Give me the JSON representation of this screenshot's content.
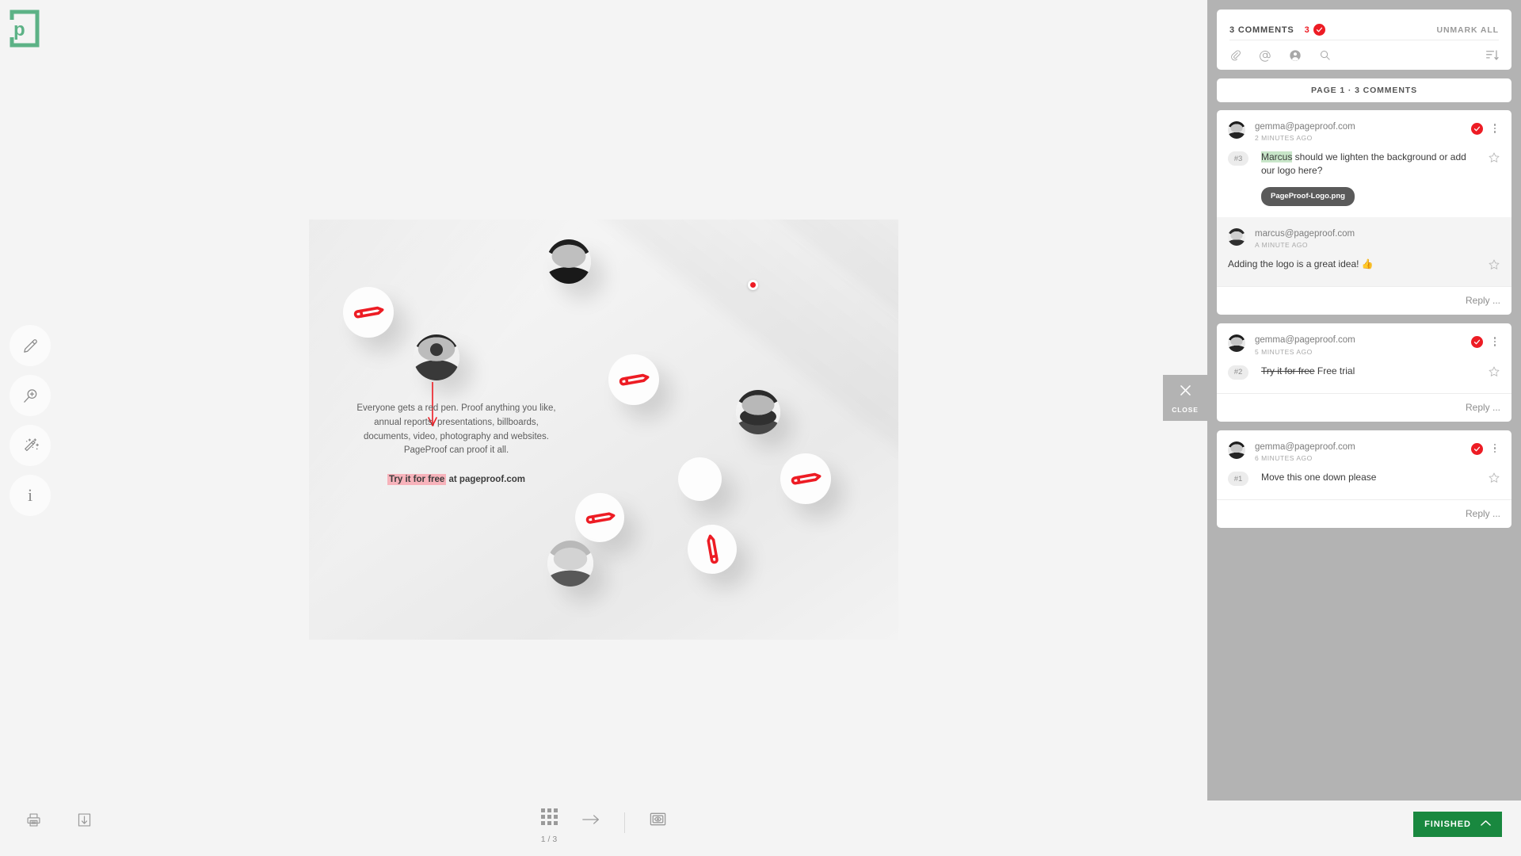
{
  "app": {
    "logo_name": "pageproof-logo",
    "brand_green": "#5cb286",
    "accent_red": "#ed1c24",
    "finished_green": "#19883f",
    "panel_grey": "#b3b3b3"
  },
  "tool_rail": {
    "items": [
      {
        "name": "pen-tool",
        "icon": "pen-icon",
        "label": "Pen"
      },
      {
        "name": "zoom-tool",
        "icon": "magnifier-icon",
        "label": "Zoom"
      },
      {
        "name": "magic-tool",
        "icon": "magic-wand-icon",
        "label": "Magic"
      },
      {
        "name": "info-tool",
        "icon": "info-icon",
        "label": "i"
      }
    ]
  },
  "viewer": {
    "close_tab": {
      "label": "CLOSE",
      "icon": "close-icon"
    },
    "artwork": {
      "body": "Everyone gets a red pen. Proof anything you like, annual reports, presentations, billboards, documents, video, photography and websites. PageProof can proof it all.",
      "cta_highlight": "Try it for free",
      "cta_rest": " at pageproof.com"
    },
    "annotations": [
      {
        "name": "arrow-annotation",
        "type": "arrow",
        "color": "#ed1c24"
      },
      {
        "name": "dot-annotation",
        "type": "dot",
        "color": "#ed1c24"
      }
    ]
  },
  "panel": {
    "header": {
      "title": "3 COMMENTS",
      "marked_count": "3",
      "check_icon": "check-icon",
      "unmark_all": "UNMARK ALL"
    },
    "tools": [
      {
        "name": "attach-icon",
        "label": "Attach"
      },
      {
        "name": "mention-icon",
        "label": "Mention"
      },
      {
        "name": "person-icon",
        "label": "Person"
      },
      {
        "name": "search-icon",
        "label": "Search"
      }
    ],
    "sort_icon": "sort-descending-icon",
    "page_separator": "PAGE 1  ·  3 COMMENTS",
    "reply_placeholder": "Reply ...",
    "comments": [
      {
        "id": "comment-3",
        "author": "gemma@pageproof.com",
        "time": "2 MINUTES AGO",
        "pin": "#3",
        "text_highlight": "Marcus",
        "text_rest": " should we lighten the background or add our logo here?",
        "attachment": "PageProof-Logo.png",
        "marked": true,
        "reply": {
          "author": "marcus@pageproof.com",
          "time": "A MINUTE AGO",
          "text": "Adding the logo is a great idea! 👍"
        }
      },
      {
        "id": "comment-2",
        "author": "gemma@pageproof.com",
        "time": "5 MINUTES AGO",
        "pin": "#2",
        "text_struck": "Try it for free",
        "text_rest": " Free trial",
        "marked": true
      },
      {
        "id": "comment-1",
        "author": "gemma@pageproof.com",
        "time": "6 MINUTES AGO",
        "pin": "#1",
        "text_rest": "Move this one down please",
        "marked": true
      }
    ]
  },
  "bottombar": {
    "print_icon": "print-icon",
    "download_icon": "download-icon",
    "grid_icon": "grid-icon",
    "page_indicator": "1 / 3",
    "next_icon": "arrow-right-icon",
    "preview_icon": "eye-preview-icon",
    "finished_label": "FINISHED",
    "finished_chevron": "chevron-up-icon"
  }
}
